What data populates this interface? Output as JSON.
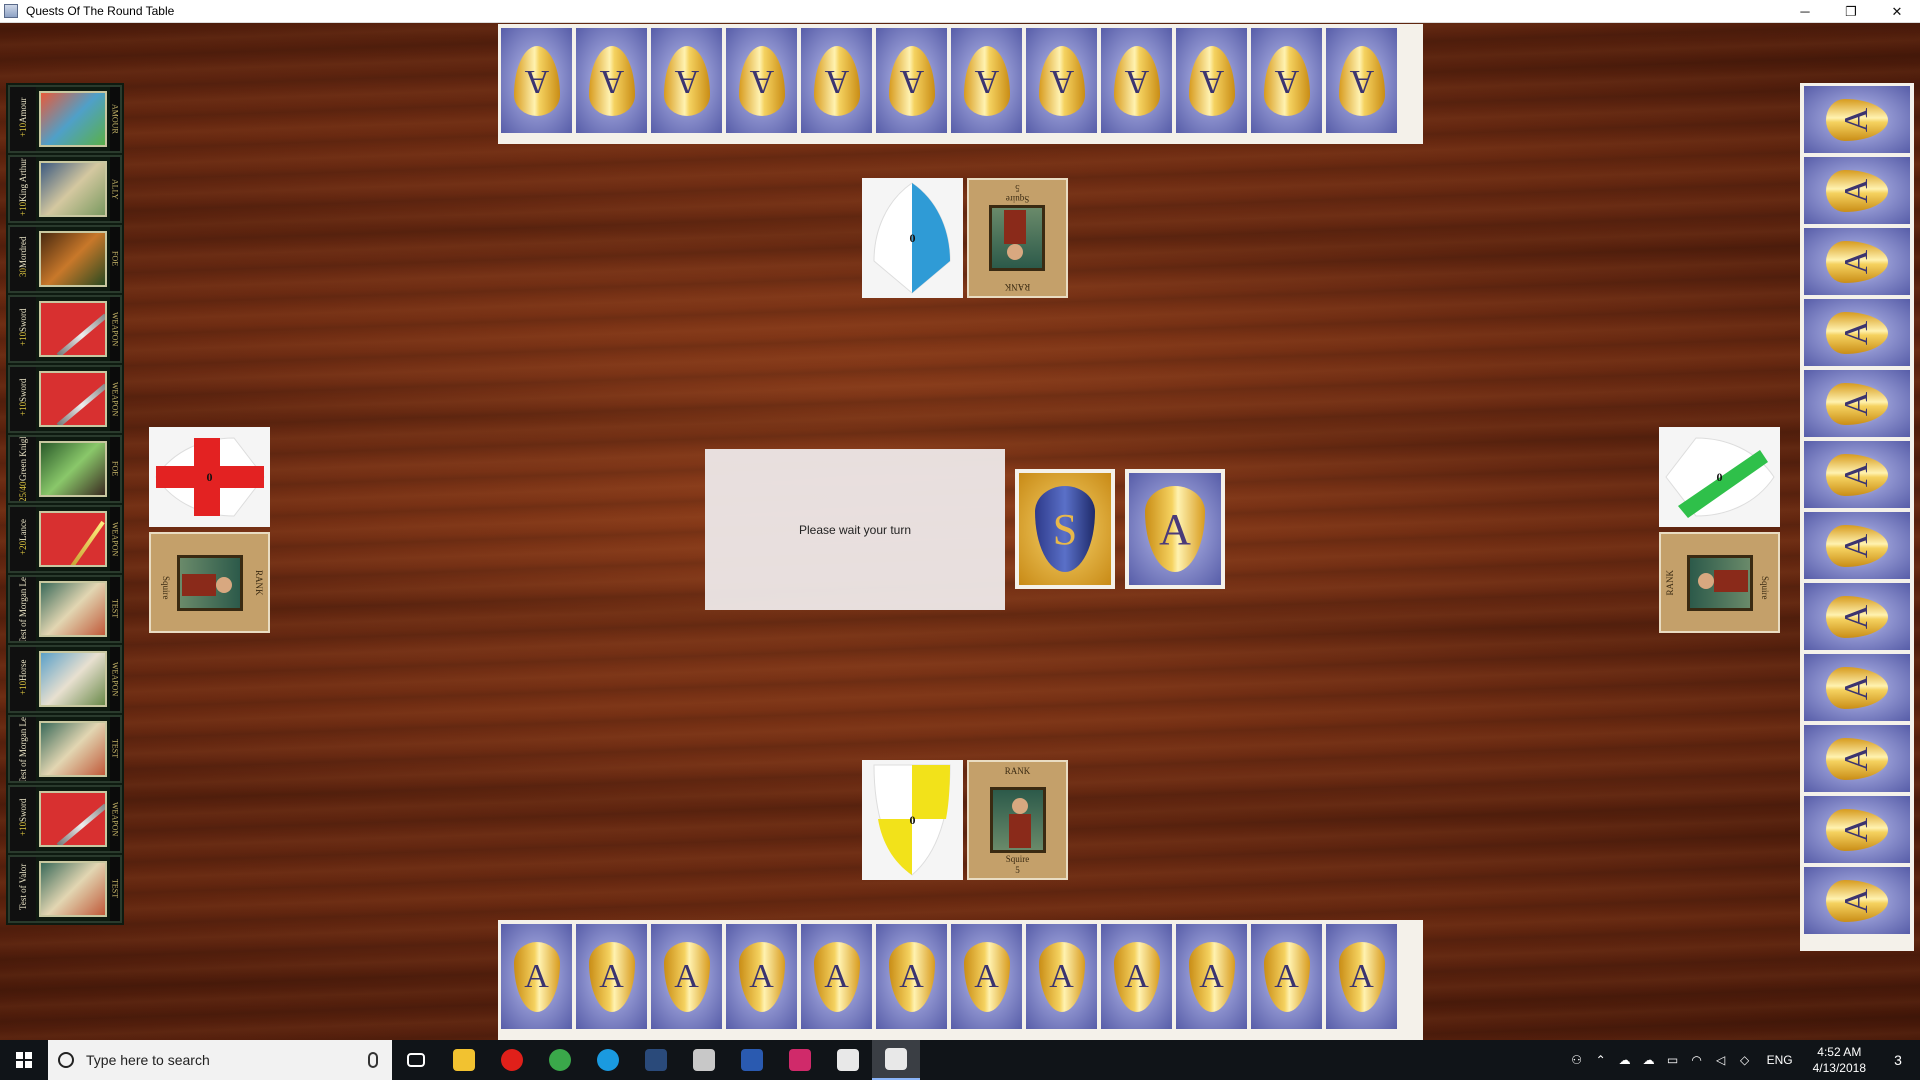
{
  "window": {
    "title": "Quests Of The Round Table",
    "minimize_glyph": "─",
    "maximize_glyph": "❐",
    "close_glyph": "✕"
  },
  "opponent_top": {
    "hand_count": 12,
    "card_back_letter": "A",
    "shield_value": "0",
    "shield_color": "#2f9bd6",
    "rank": {
      "header": "RANK",
      "title": "Squire",
      "value": "5"
    }
  },
  "opponent_left": {
    "shield_value": "0",
    "shield_color": "#e32222",
    "rank": {
      "header": "RANK",
      "title": "Squire",
      "value": "5"
    }
  },
  "opponent_right": {
    "hand_count": 12,
    "card_back_letter": "A",
    "shield_value": "0",
    "shield_color": "#2fc04a",
    "rank": {
      "header": "RANK",
      "title": "Squire",
      "value": "5"
    }
  },
  "player": {
    "hand_count": 12,
    "card_back_letter": "A",
    "shield_value": "0",
    "shield_color": "#f2e21a",
    "rank": {
      "header": "RANK",
      "title": "Squire",
      "value": "5"
    }
  },
  "left_cards": [
    {
      "name": "Amour",
      "value": "+10",
      "type": "AMOUR",
      "art": "amour"
    },
    {
      "name": "King Arthur",
      "value": "+10",
      "type": "ALLY",
      "art": "ally"
    },
    {
      "name": "Mordred",
      "value": "30",
      "type": "FOE",
      "art": "foe"
    },
    {
      "name": "Sword",
      "value": "+10",
      "type": "WEAPON",
      "art": "weapon"
    },
    {
      "name": "Sword",
      "value": "+10",
      "type": "WEAPON",
      "art": "weapon"
    },
    {
      "name": "Green Knight",
      "value": "25/40",
      "type": "FOE",
      "art": "foe2"
    },
    {
      "name": "Lance",
      "value": "+20",
      "type": "WEAPON",
      "art": "lance"
    },
    {
      "name": "Test of Morgan Le F",
      "value": "",
      "type": "TEST",
      "art": "test"
    },
    {
      "name": "Horse",
      "value": "+10",
      "type": "WEAPON",
      "art": "horse"
    },
    {
      "name": "Test of Morgan Le F",
      "value": "",
      "type": "TEST",
      "art": "test"
    },
    {
      "name": "Sword",
      "value": "+10",
      "type": "WEAPON",
      "art": "weapon"
    },
    {
      "name": "Test of Valor",
      "value": "",
      "type": "TEST",
      "art": "test"
    }
  ],
  "message": "Please wait your turn",
  "decks": {
    "story_letter": "S",
    "adventure_letter": "A"
  },
  "taskbar": {
    "search_placeholder": "Type here to search",
    "language": "ENG",
    "time": "4:52 AM",
    "date": "4/13/2018",
    "notification_count": "3",
    "apps": [
      {
        "name": "task-view",
        "color": "#ffffff"
      },
      {
        "name": "file-explorer",
        "color": "#f2c230"
      },
      {
        "name": "opera",
        "color": "#e0201a"
      },
      {
        "name": "chrome",
        "color": "#3aa84a"
      },
      {
        "name": "skype",
        "color": "#1a9ae0"
      },
      {
        "name": "steam",
        "color": "#2a4a7a"
      },
      {
        "name": "app-ship",
        "color": "#c8c8c8"
      },
      {
        "name": "word",
        "color": "#2a5ab0"
      },
      {
        "name": "intellij",
        "color": "#d02a6a"
      },
      {
        "name": "java",
        "color": "#e8e8e8"
      },
      {
        "name": "game-window",
        "color": "#e8e8e8"
      }
    ]
  }
}
